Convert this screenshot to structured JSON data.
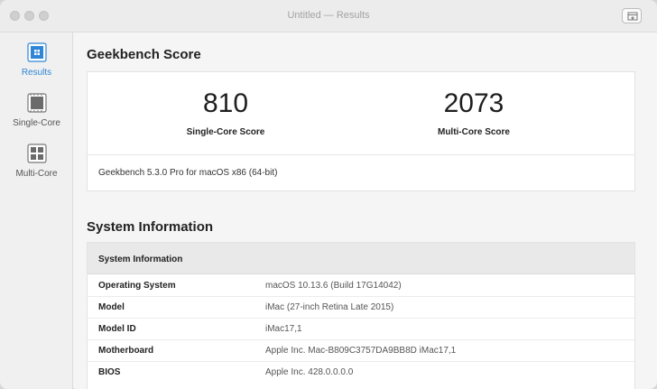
{
  "window": {
    "title": "Untitled — Results"
  },
  "sidebar": {
    "items": [
      {
        "label": "Results",
        "icon": "results-icon",
        "active": true
      },
      {
        "label": "Single-Core",
        "icon": "single-core-icon",
        "active": false
      },
      {
        "label": "Multi-Core",
        "icon": "multi-core-icon",
        "active": false
      }
    ]
  },
  "scores": {
    "heading": "Geekbench Score",
    "single": {
      "value": "810",
      "label": "Single-Core Score"
    },
    "multi": {
      "value": "2073",
      "label": "Multi-Core Score"
    },
    "version": "Geekbench 5.3.0 Pro for macOS x86 (64-bit)"
  },
  "system": {
    "heading": "System Information",
    "table_header": "System Information",
    "rows": [
      {
        "key": "Operating System",
        "value": "macOS 10.13.6 (Build 17G14042)"
      },
      {
        "key": "Model",
        "value": "iMac (27-inch Retina Late 2015)"
      },
      {
        "key": "Model ID",
        "value": "iMac17,1"
      },
      {
        "key": "Motherboard",
        "value": "Apple Inc. Mac-B809C3757DA9BB8D iMac17,1"
      },
      {
        "key": "BIOS",
        "value": "Apple Inc. 428.0.0.0.0"
      }
    ]
  },
  "colors": {
    "accent": "#2f86d6"
  }
}
